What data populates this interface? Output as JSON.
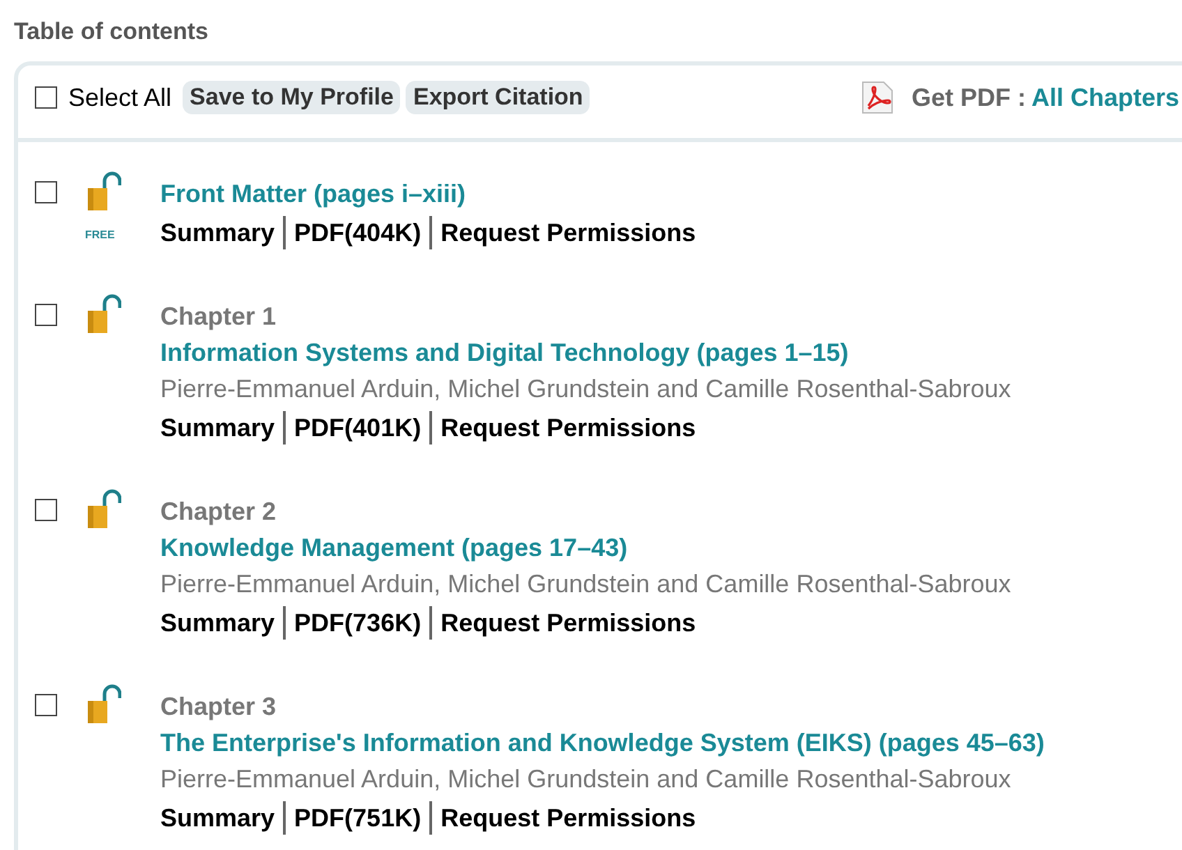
{
  "heading": "Table of contents",
  "toolbar": {
    "select_all": {
      "label": "Select All",
      "checked": false
    },
    "buttons": [
      "Save to My Profile",
      "Export Citation"
    ],
    "get_pdf": {
      "label": "Get PDF :",
      "link": "All Chapters"
    }
  },
  "entries": [
    {
      "checked": false,
      "badge": "FREE",
      "title": "Front Matter (pages i–xiii)",
      "links": [
        "Summary",
        "PDF(404K)",
        "Request Permissions"
      ]
    },
    {
      "checked": false,
      "chapter": "Chapter 1",
      "title": "Information Systems and Digital Technology (pages 1–15)",
      "authors": "Pierre-Emmanuel Arduin, Michel Grundstein and Camille Rosenthal-Sabroux",
      "links": [
        "Summary",
        "PDF(401K)",
        "Request Permissions"
      ]
    },
    {
      "checked": false,
      "chapter": "Chapter 2",
      "title": "Knowledge Management (pages 17–43)",
      "authors": "Pierre-Emmanuel Arduin, Michel Grundstein and Camille Rosenthal-Sabroux",
      "links": [
        "Summary",
        "PDF(736K)",
        "Request Permissions"
      ]
    },
    {
      "checked": false,
      "chapter": "Chapter 3",
      "title": "The Enterprise's Information and Knowledge System (EIKS) (pages 45–63)",
      "authors": "Pierre-Emmanuel Arduin, Michel Grundstein and Camille Rosenthal-Sabroux",
      "links": [
        "Summary",
        "PDF(751K)",
        "Request Permissions"
      ]
    }
  ]
}
